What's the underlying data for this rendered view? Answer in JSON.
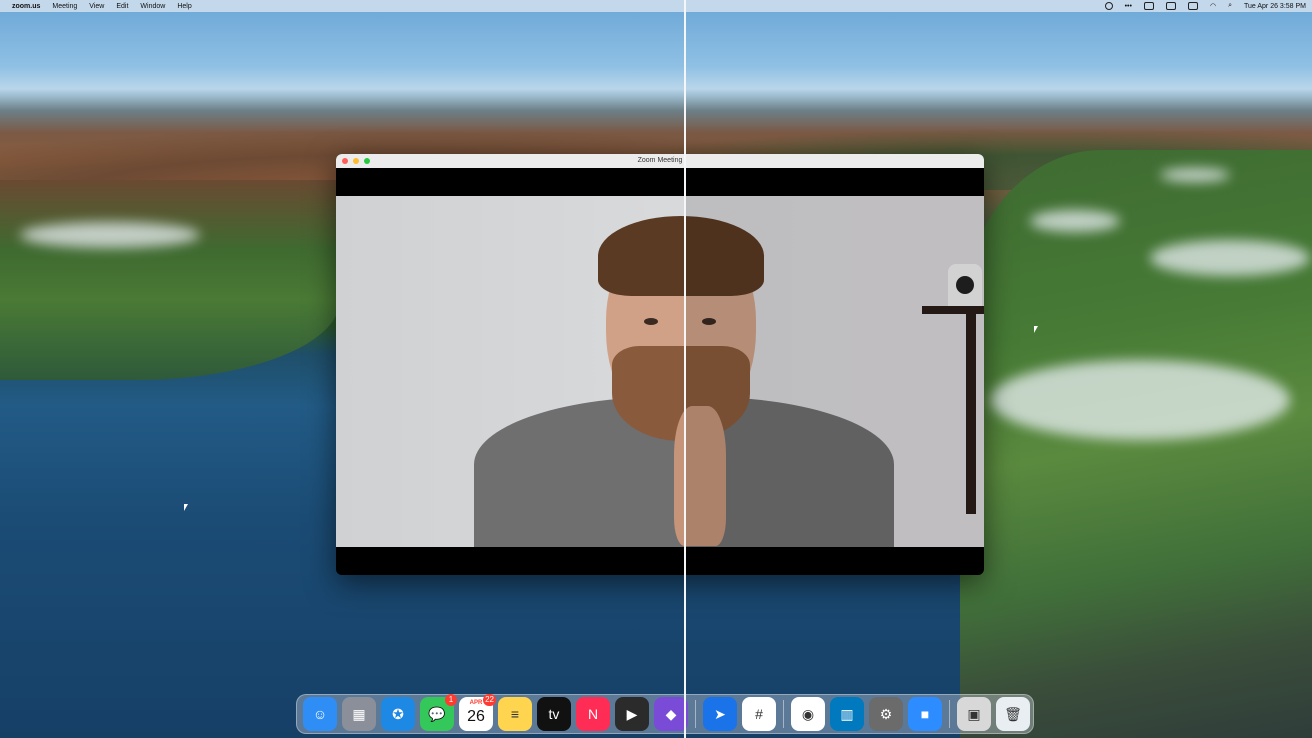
{
  "menubar": {
    "app_name": "zoom.us",
    "menus": [
      "Meeting",
      "View",
      "Edit",
      "Window",
      "Help"
    ],
    "clock": "Tue Apr 26  3:58 PM"
  },
  "window": {
    "title": "Zoom Meeting"
  },
  "dock": {
    "apps": [
      {
        "name": "Finder",
        "glyph": "☺",
        "color": "#2f8ef6"
      },
      {
        "name": "Launchpad",
        "glyph": "▦",
        "color": "#8a8f99"
      },
      {
        "name": "Safari",
        "glyph": "✪",
        "color": "#1e88e5"
      },
      {
        "name": "Messages",
        "glyph": "💬",
        "color": "#34c759",
        "badge": "1"
      },
      {
        "name": "Calendar",
        "month": "APR",
        "day": "26",
        "color": "#ffffff",
        "badge": "22"
      },
      {
        "name": "Notes",
        "glyph": "≡",
        "color": "#ffd54f"
      },
      {
        "name": "Apple TV",
        "glyph": "tv",
        "color": "#111111"
      },
      {
        "name": "News",
        "glyph": "N",
        "color": "#ff2d55"
      },
      {
        "name": "Final Cut Pro",
        "glyph": "▶",
        "color": "#2b2b2b"
      },
      {
        "name": "Affinity Photo",
        "glyph": "◆",
        "color": "#7a4bd6"
      },
      {
        "name": "Spark",
        "glyph": "➤",
        "color": "#1a73e8"
      },
      {
        "name": "Slack",
        "glyph": "#",
        "color": "#ffffff"
      },
      {
        "name": "Chrome",
        "glyph": "◉",
        "color": "#ffffff"
      },
      {
        "name": "Trello",
        "glyph": "▥",
        "color": "#0079bf"
      },
      {
        "name": "System Preferences",
        "glyph": "⚙",
        "color": "#6b6b6b"
      },
      {
        "name": "Zoom",
        "glyph": "■",
        "color": "#2d8cff"
      },
      {
        "name": "Recent Window",
        "glyph": "▣",
        "color": "#d8d8d8"
      },
      {
        "name": "Trash",
        "glyph": "🗑",
        "color": "#e8eef2"
      }
    ]
  },
  "colors": {
    "divider": "#f4f6f8",
    "zoom_blue": "#2d8cff"
  }
}
